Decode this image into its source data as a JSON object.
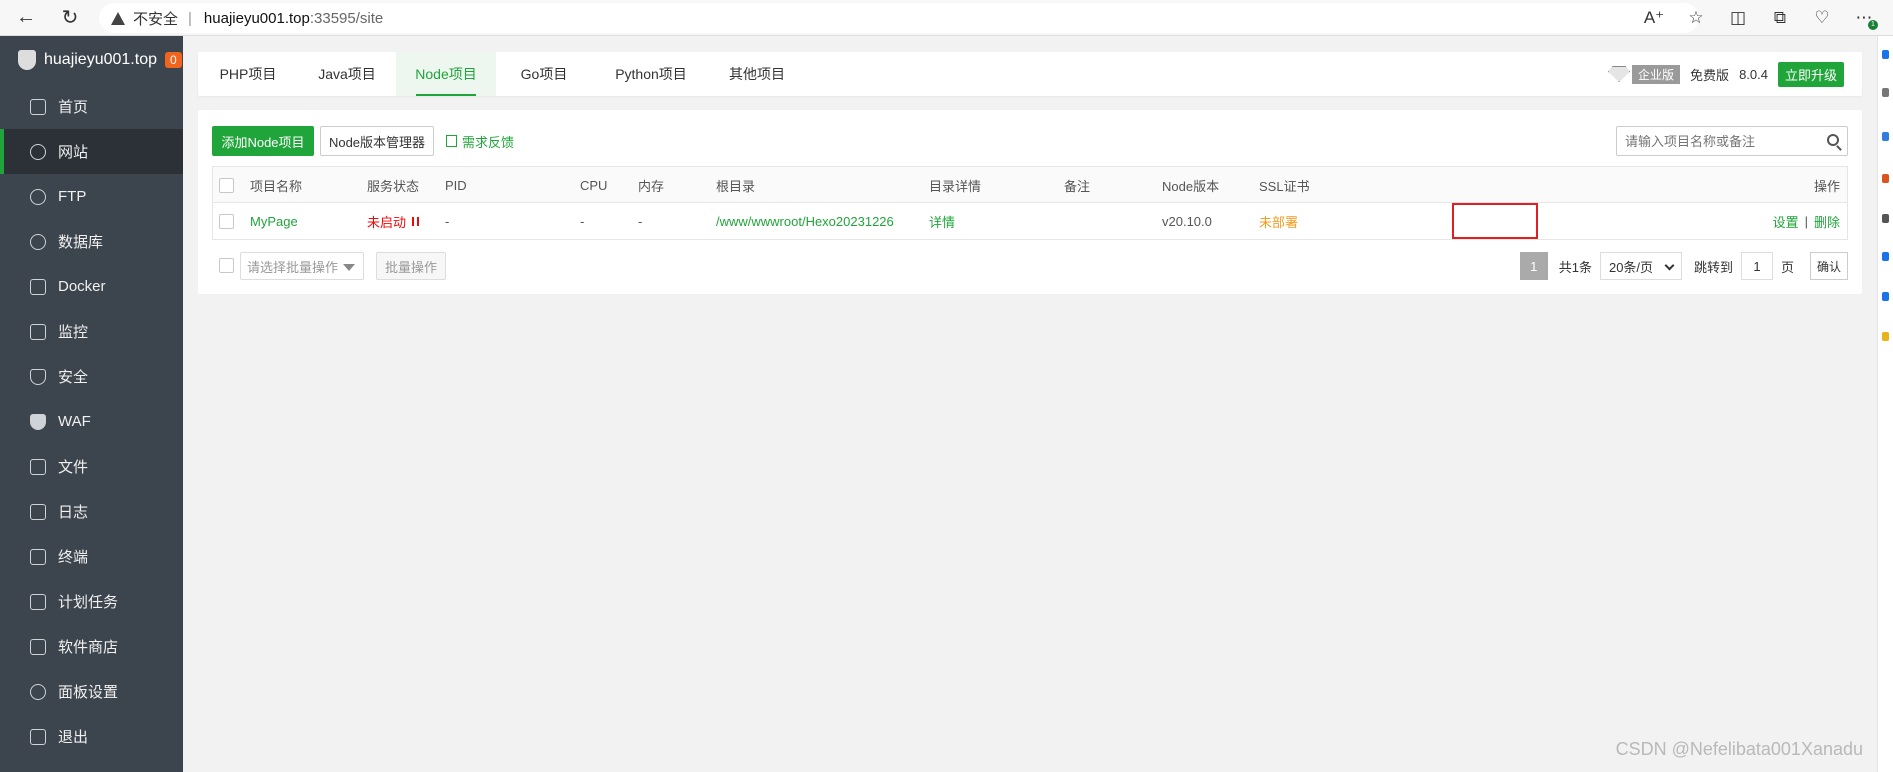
{
  "browser": {
    "insecure_label": "不安全",
    "url_host": "huajieyu001.top",
    "url_rest": ":33595/site",
    "icons": [
      "back-icon",
      "refresh-icon",
      "read-aloud-icon",
      "favorite-icon",
      "split-icon",
      "collections-icon",
      "health-icon",
      "more-icon"
    ],
    "notification_count": "1"
  },
  "sidebar": {
    "brand": "huajieyu001.top",
    "badge": "0",
    "items": [
      {
        "label": "首页",
        "icon": "home-icon"
      },
      {
        "label": "网站",
        "icon": "globe-icon",
        "active": true
      },
      {
        "label": "FTP",
        "icon": "ftp-icon"
      },
      {
        "label": "数据库",
        "icon": "database-icon"
      },
      {
        "label": "Docker",
        "icon": "docker-icon"
      },
      {
        "label": "监控",
        "icon": "monitor-icon"
      },
      {
        "label": "安全",
        "icon": "shield-icon"
      },
      {
        "label": "WAF",
        "icon": "waf-icon"
      },
      {
        "label": "文件",
        "icon": "folder-icon"
      },
      {
        "label": "日志",
        "icon": "log-icon"
      },
      {
        "label": "终端",
        "icon": "terminal-icon"
      },
      {
        "label": "计划任务",
        "icon": "calendar-icon"
      },
      {
        "label": "软件商店",
        "icon": "apps-icon"
      },
      {
        "label": "面板设置",
        "icon": "gear-icon"
      },
      {
        "label": "退出",
        "icon": "logout-icon"
      }
    ]
  },
  "tabs": [
    {
      "label": "PHP项目"
    },
    {
      "label": "Java项目"
    },
    {
      "label": "Node项目",
      "active": true
    },
    {
      "label": "Go项目"
    },
    {
      "label": "Python项目"
    },
    {
      "label": "其他项目"
    }
  ],
  "version": {
    "edition_badge": "企业版",
    "free_label": "免费版",
    "number": "8.0.4",
    "upgrade_label": "立即升级"
  },
  "toolbar": {
    "add_label": "添加Node项目",
    "manager_label": "Node版本管理器",
    "feedback_label": "需求反馈",
    "search_placeholder": "请输入项目名称或备注"
  },
  "table": {
    "headers": {
      "name": "项目名称",
      "status": "服务状态",
      "pid": "PID",
      "cpu": "CPU",
      "memory": "内存",
      "root": "根目录",
      "dir_detail": "目录详情",
      "note": "备注",
      "node_version": "Node版本",
      "ssl": "SSL证书",
      "actions": "操作"
    },
    "rows": [
      {
        "name": "MyPage",
        "status": "未启动",
        "pid": "-",
        "cpu": "-",
        "memory": "-",
        "root": "/www/wwwroot/Hexo20231226",
        "dir_detail": "详情",
        "note": "",
        "node_version": "v20.10.0",
        "ssl": "未部署",
        "action_settings": "设置",
        "action_sep": "|",
        "action_delete": "删除"
      }
    ]
  },
  "footer": {
    "batch_placeholder": "请选择批量操作",
    "batch_button": "批量操作",
    "current_page": "1",
    "total_label": "共1条",
    "page_size": "20条/页",
    "jump_label": "跳转到",
    "jump_value": "1",
    "page_unit": "页",
    "confirm_label": "确认"
  },
  "watermark": "CSDN @Nefelibata001Xanadu",
  "colors": {
    "accent": "#20a53a",
    "sidebar_bg": "#3c444d",
    "danger": "#ef0808",
    "warning": "#f59b22",
    "highlight_box": "#e02020"
  }
}
